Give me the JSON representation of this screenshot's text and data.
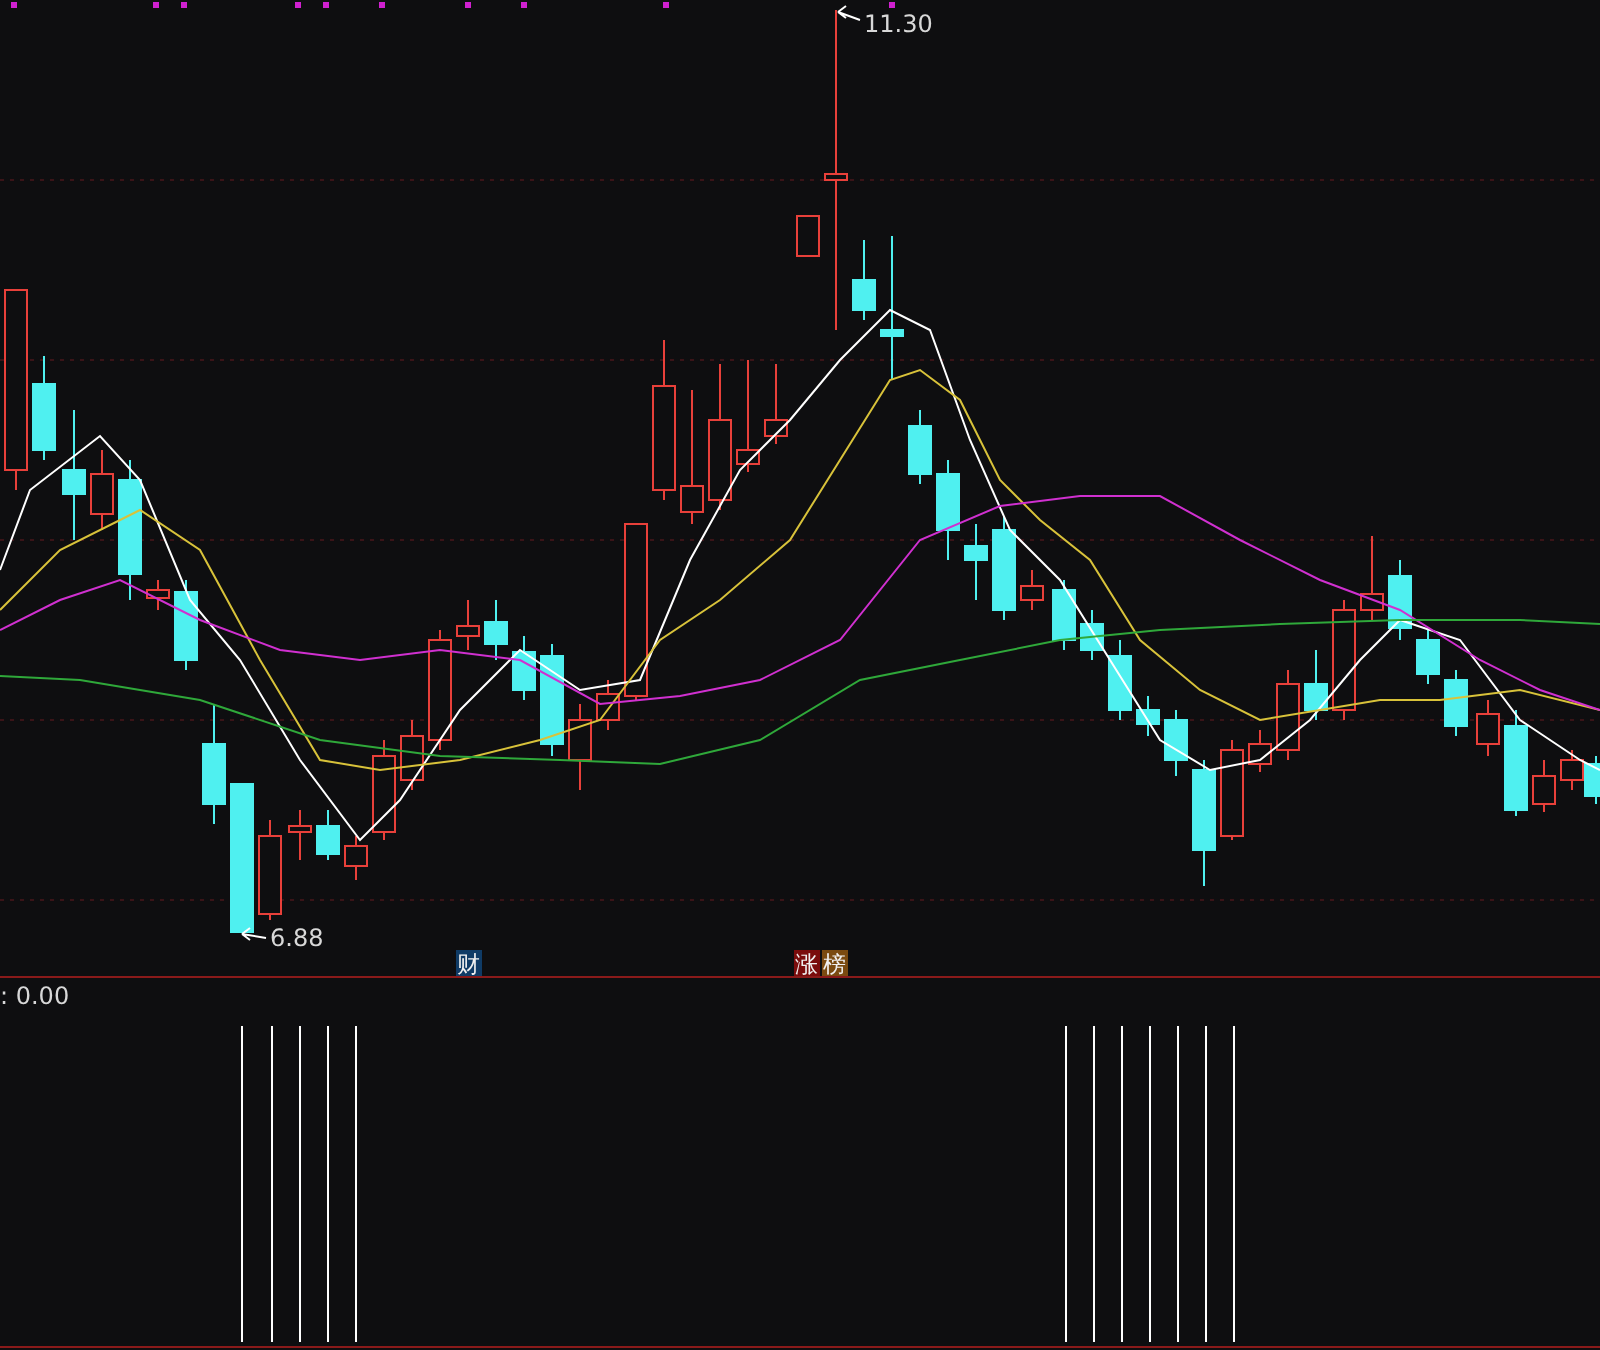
{
  "price_chart": {
    "high_label": "11.30",
    "low_label": "6.88",
    "badges": [
      {
        "text": "财",
        "color": "#0f3b66"
      },
      {
        "text": "涨",
        "color": "#7a0c0c"
      },
      {
        "text": "榜",
        "color": "#7a4a10"
      }
    ]
  },
  "indicator_panel": {
    "reading": ": 0.00"
  }
}
